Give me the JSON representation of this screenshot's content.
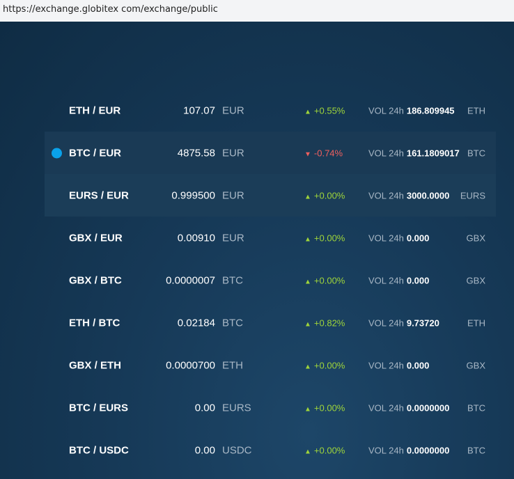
{
  "url": "https://exchange.globitex com/exchange/public",
  "vol_label": "VOL 24h",
  "colors": {
    "up": "#9fd53a",
    "down": "#f0605f",
    "selected_dot": "#0aa2ea"
  },
  "rows": [
    {
      "pair": "ETH / EUR",
      "price": "107.07",
      "currency": "EUR",
      "dir": "up",
      "change": "+0.55%",
      "volume": "186.809945",
      "unit": "ETH"
    },
    {
      "pair": "BTC / EUR",
      "price": "4875.58",
      "currency": "EUR",
      "dir": "down",
      "change": "-0.74%",
      "volume": "161.1809017",
      "unit": "BTC",
      "selected": true
    },
    {
      "pair": "EURS / EUR",
      "price": "0.999500",
      "currency": "EUR",
      "dir": "up",
      "change": "+0.00%",
      "volume": "3000.0000",
      "unit": "EURS"
    },
    {
      "pair": "GBX / EUR",
      "price": "0.00910",
      "currency": "EUR",
      "dir": "up",
      "change": "+0.00%",
      "volume": "0.000",
      "unit": "GBX"
    },
    {
      "pair": "GBX / BTC",
      "price": "0.0000007",
      "currency": "BTC",
      "dir": "up",
      "change": "+0.00%",
      "volume": "0.000",
      "unit": "GBX"
    },
    {
      "pair": "ETH / BTC",
      "price": "0.02184",
      "currency": "BTC",
      "dir": "up",
      "change": "+0.82%",
      "volume": "9.73720",
      "unit": "ETH"
    },
    {
      "pair": "GBX / ETH",
      "price": "0.0000700",
      "currency": "ETH",
      "dir": "up",
      "change": "+0.00%",
      "volume": "0.000",
      "unit": "GBX"
    },
    {
      "pair": "BTC / EURS",
      "price": "0.00",
      "currency": "EURS",
      "dir": "up",
      "change": "+0.00%",
      "volume": "0.0000000",
      "unit": "BTC"
    },
    {
      "pair": "BTC / USDC",
      "price": "0.00",
      "currency": "USDC",
      "dir": "up",
      "change": "+0.00%",
      "volume": "0.0000000",
      "unit": "BTC"
    }
  ]
}
